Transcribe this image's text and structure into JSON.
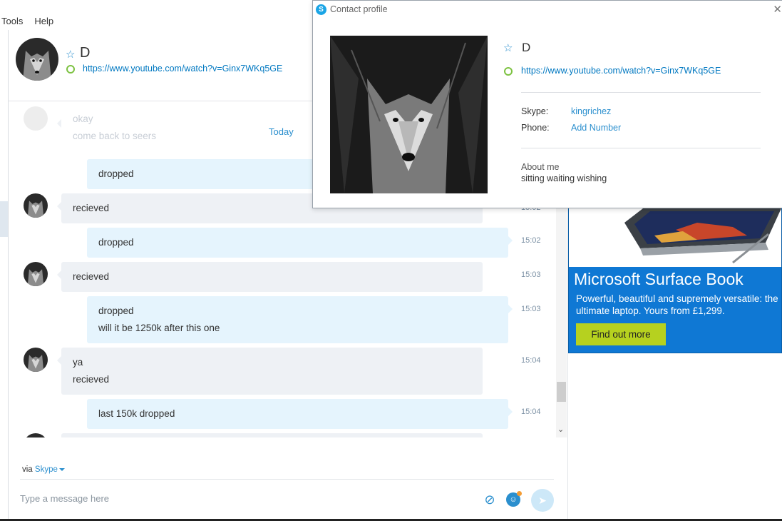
{
  "menu": [
    "Tools",
    "Help"
  ],
  "header": {
    "contact_name": "D",
    "mood_link": "https://www.youtube.com/watch?v=Ginx7WKq5GE"
  },
  "messages": {
    "date_separator": "Today",
    "faded_lines": [
      "okay",
      "come back to seers"
    ],
    "items": [
      {
        "direction": "out",
        "lines": [
          "dropped"
        ],
        "time": ""
      },
      {
        "direction": "in",
        "lines": [
          "recieved"
        ],
        "time": "15:02"
      },
      {
        "direction": "out",
        "lines": [
          "dropped"
        ],
        "time": "15:02"
      },
      {
        "direction": "in",
        "lines": [
          "recieved"
        ],
        "time": "15:03"
      },
      {
        "direction": "out",
        "lines": [
          "dropped",
          "will it be 1250k after this one"
        ],
        "time": "15:03"
      },
      {
        "direction": "in",
        "lines": [
          "ya",
          "recieved"
        ],
        "time": "15:04"
      },
      {
        "direction": "out",
        "lines": [
          "last 150k dropped"
        ],
        "time": "15:04"
      }
    ]
  },
  "composer": {
    "via_prefix": "via",
    "via_channel": "Skype",
    "placeholder": "Type a message here"
  },
  "ad": {
    "title": "Microsoft Surface Book",
    "body": "Powerful, beautiful and supremely versatile: the ultimate laptop. Yours from £1,299.",
    "button": "Find out more"
  },
  "profile": {
    "window_title": "Contact profile",
    "name": "D",
    "mood_link": "https://www.youtube.com/watch?v=Ginx7WKq5GE",
    "skype_label": "Skype:",
    "skype_value": "kingrichez",
    "phone_label": "Phone:",
    "phone_value": "Add Number",
    "about_label": "About me",
    "about_value": "sitting waiting wishing"
  },
  "colors": {
    "accent": "#2b8fce",
    "online": "#7dc242",
    "incoming_bubble": "#eef1f5",
    "outgoing_bubble": "#e5f4fd",
    "ad_blue": "#0f78d4",
    "ad_button": "#b6d11f"
  }
}
